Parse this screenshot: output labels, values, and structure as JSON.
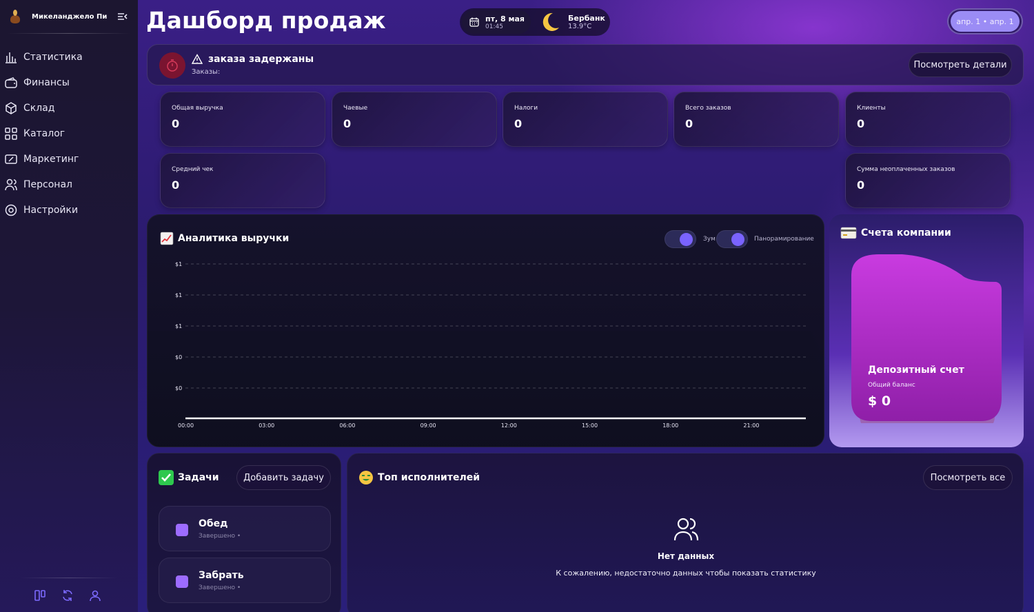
{
  "sidebar": {
    "user_name": "Микеланджело Пи...",
    "items": [
      {
        "label": "Статистика",
        "icon": "bar-chart-icon"
      },
      {
        "label": "Финансы",
        "icon": "wallet-icon"
      },
      {
        "label": "Склад",
        "icon": "box-icon"
      },
      {
        "label": "Каталог",
        "icon": "grid-icon"
      },
      {
        "label": "Маркетинг",
        "icon": "ticket-icon"
      },
      {
        "label": "Персонал",
        "icon": "users-icon"
      },
      {
        "label": "Настройки",
        "icon": "settings-icon"
      }
    ]
  },
  "header": {
    "title": "Дашборд продаж",
    "date": "пт, 8 мая",
    "time": "01:45",
    "weather_city": "Бербанк",
    "weather_temp": "13.9°C",
    "range_label": "апр. 1 • апр. 1"
  },
  "alert": {
    "title": "заказа задержаны",
    "subtitle": "Заказы:",
    "button": "Посмотреть детали",
    "color": "#7a1430"
  },
  "stats": [
    {
      "label": "Общая выручка",
      "value": "0"
    },
    {
      "label": "Чаевые",
      "value": "0"
    },
    {
      "label": "Налоги",
      "value": "0"
    },
    {
      "label": "Всего заказов",
      "value": "0"
    },
    {
      "label": "Клиенты",
      "value": "0"
    },
    {
      "label": "Средний чек",
      "value": "0"
    },
    {
      "label": "Сумма неоплаченных заказов",
      "value": "0"
    }
  ],
  "analytics": {
    "title": "Аналитика выручки",
    "zoom_label": "Зум",
    "pan_label": "Панорамирование"
  },
  "chart_data": {
    "type": "line",
    "title": "Аналитика выручки",
    "x_ticks": [
      "00:00",
      "03:00",
      "06:00",
      "09:00",
      "12:00",
      "15:00",
      "18:00",
      "21:00"
    ],
    "y_ticks": [
      "$1",
      "$1",
      "$1",
      "$0",
      "$0"
    ],
    "series": [
      {
        "values": [
          0,
          0,
          0,
          0,
          0,
          0,
          0,
          0
        ]
      }
    ],
    "grid": true,
    "line_color": "#ffffff"
  },
  "accounts": {
    "title": "Счета компании",
    "account_name": "Депозитный счет",
    "balance_label": "Общий баланс",
    "balance": "$ 0"
  },
  "tasks": {
    "title": "Задачи",
    "add_button": "Добавить задачу",
    "items": [
      {
        "title": "Обед",
        "status": "Завершено •"
      },
      {
        "title": "Забрать",
        "status": "Завершено •"
      }
    ]
  },
  "top": {
    "title": "Топ исполнителей",
    "view_all": "Посмотреть все",
    "empty_title": "Нет данных",
    "empty_text": "К сожалению, недостаточно данных чтобы показать статистику"
  },
  "colors": {
    "accent": "#7a63ff",
    "checkbox": "#9d6cff"
  }
}
